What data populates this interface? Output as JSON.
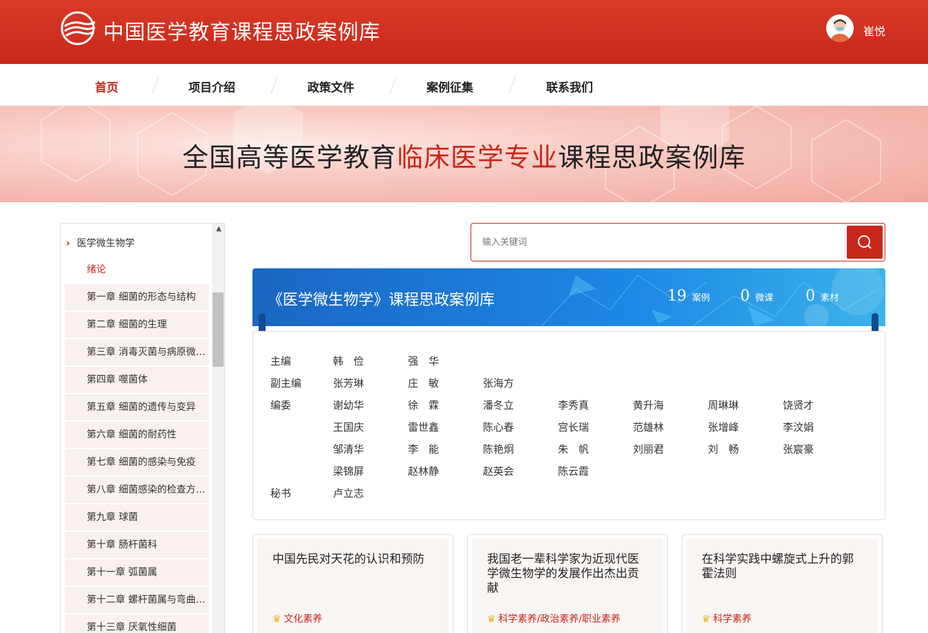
{
  "header": {
    "site_title": "中国医学教育课程思政案例库",
    "username": "崔悦"
  },
  "nav": {
    "items": [
      {
        "label": "首页",
        "active": true
      },
      {
        "label": "项目介绍",
        "active": false
      },
      {
        "label": "政策文件",
        "active": false
      },
      {
        "label": "案例征集",
        "active": false
      },
      {
        "label": "联系我们",
        "active": false
      }
    ]
  },
  "banner": {
    "prefix": "全国高等医学教育",
    "highlight": "临床医学专业",
    "suffix": "课程思政案例库"
  },
  "sidebar": {
    "root": "医学微生物学",
    "items": [
      "绪论",
      "第一章 细菌的形态与结构",
      "第二章 细菌的生理",
      "第三章 消毒灭菌与病原微生物实验室生物安全",
      "第四章 噬菌体",
      "第五章 细菌的遗传与变异",
      "第六章 细菌的耐药性",
      "第七章 细菌的感染与免疫",
      "第八章 细菌感染的检查方法与防治原则",
      "第九章 球菌",
      "第十章 肠杆菌科",
      "第十一章 弧菌属",
      "第十二章 螺杆菌属与弯曲菌属",
      "第十三章 厌氧性细菌"
    ]
  },
  "search": {
    "placeholder": "输入关键词"
  },
  "course": {
    "title": "《医学微生物学》课程思政案例库",
    "stats": [
      {
        "num": "19",
        "label": "案例"
      },
      {
        "num": "0",
        "label": "微课"
      },
      {
        "num": "0",
        "label": "素材"
      }
    ]
  },
  "editors": {
    "chief_label": "主编",
    "chief": [
      "韩　俭",
      "强　华"
    ],
    "deputy_label": "副主编",
    "deputy": [
      "张芳琳",
      "庄　敏",
      "张海方"
    ],
    "committee_label": "编委",
    "committee": [
      "谢幼华",
      "徐　霖",
      "潘冬立",
      "李秀真",
      "黄升海",
      "周琳琳",
      "饶贤才",
      "王国庆",
      "雷世鑫",
      "陈心春",
      "宫长瑞",
      "范雄林",
      "张增峰",
      "李汶娟",
      "邹清华",
      "李　能",
      "陈艳炯",
      "朱　帆",
      "刘丽君",
      "刘　畅",
      "张宸豪",
      "梁锦屏",
      "赵林静",
      "赵英会",
      "陈云霞"
    ],
    "secretary_label": "秘书",
    "secretary": [
      "卢立志"
    ]
  },
  "cards": [
    {
      "title": "中国先民对天花的认识和预防",
      "tag": "文化素养"
    },
    {
      "title": "我国老一辈科学家为近现代医学微生物学的发展作出杰出贡献",
      "tag": "科学素养/政治素养/职业素养"
    },
    {
      "title": "在科学实践中螺旋式上升的郭霍法则",
      "tag": "科学素养"
    }
  ],
  "colors": {
    "brand_red": "#c8271a",
    "course_blue": "#1e88e5",
    "tag_star": "#f3b21c"
  }
}
